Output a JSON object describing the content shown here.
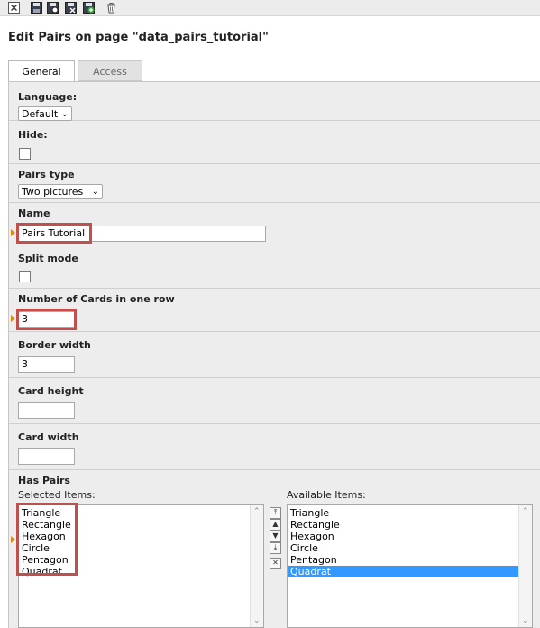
{
  "toolbar": {
    "buttons": [
      {
        "icon": "close-icon"
      },
      {
        "icon": "save-icon"
      },
      {
        "icon": "save-view-icon"
      },
      {
        "icon": "save-close-icon"
      },
      {
        "icon": "save-new-icon"
      },
      {
        "icon": "delete-icon"
      }
    ]
  },
  "page": {
    "title": "Edit Pairs on page \"data_pairs_tutorial\""
  },
  "tabs": [
    {
      "label": "General",
      "active": true
    },
    {
      "label": "Access",
      "active": false
    }
  ],
  "form": {
    "language": {
      "label": "Language:",
      "value": "Default"
    },
    "hide": {
      "label": "Hide:",
      "checked": false
    },
    "pairs_type": {
      "label": "Pairs type",
      "value": "Two pictures"
    },
    "name": {
      "label": "Name",
      "value": "Pairs Tutorial"
    },
    "split_mode": {
      "label": "Split mode",
      "checked": false
    },
    "cards_per_row": {
      "label": "Number of Cards in one row",
      "value": "3"
    },
    "border_width": {
      "label": "Border width",
      "value": "3"
    },
    "card_height": {
      "label": "Card height",
      "value": ""
    },
    "card_width": {
      "label": "Card width",
      "value": ""
    },
    "has_pairs": {
      "label": "Has Pairs",
      "selected_label": "Selected Items:",
      "available_label": "Available Items:",
      "selected_items": [
        "Triangle",
        "Rectangle",
        "Hexagon",
        "Circle",
        "Pentagon",
        "Quadrat"
      ],
      "available_items": [
        "Triangle",
        "Rectangle",
        "Hexagon",
        "Circle",
        "Pentagon",
        "Quadrat"
      ],
      "available_selected": "Quadrat"
    }
  },
  "colors": {
    "highlight": "#c0504d",
    "selection": "#3399ff",
    "marker": "#d98c1a"
  }
}
